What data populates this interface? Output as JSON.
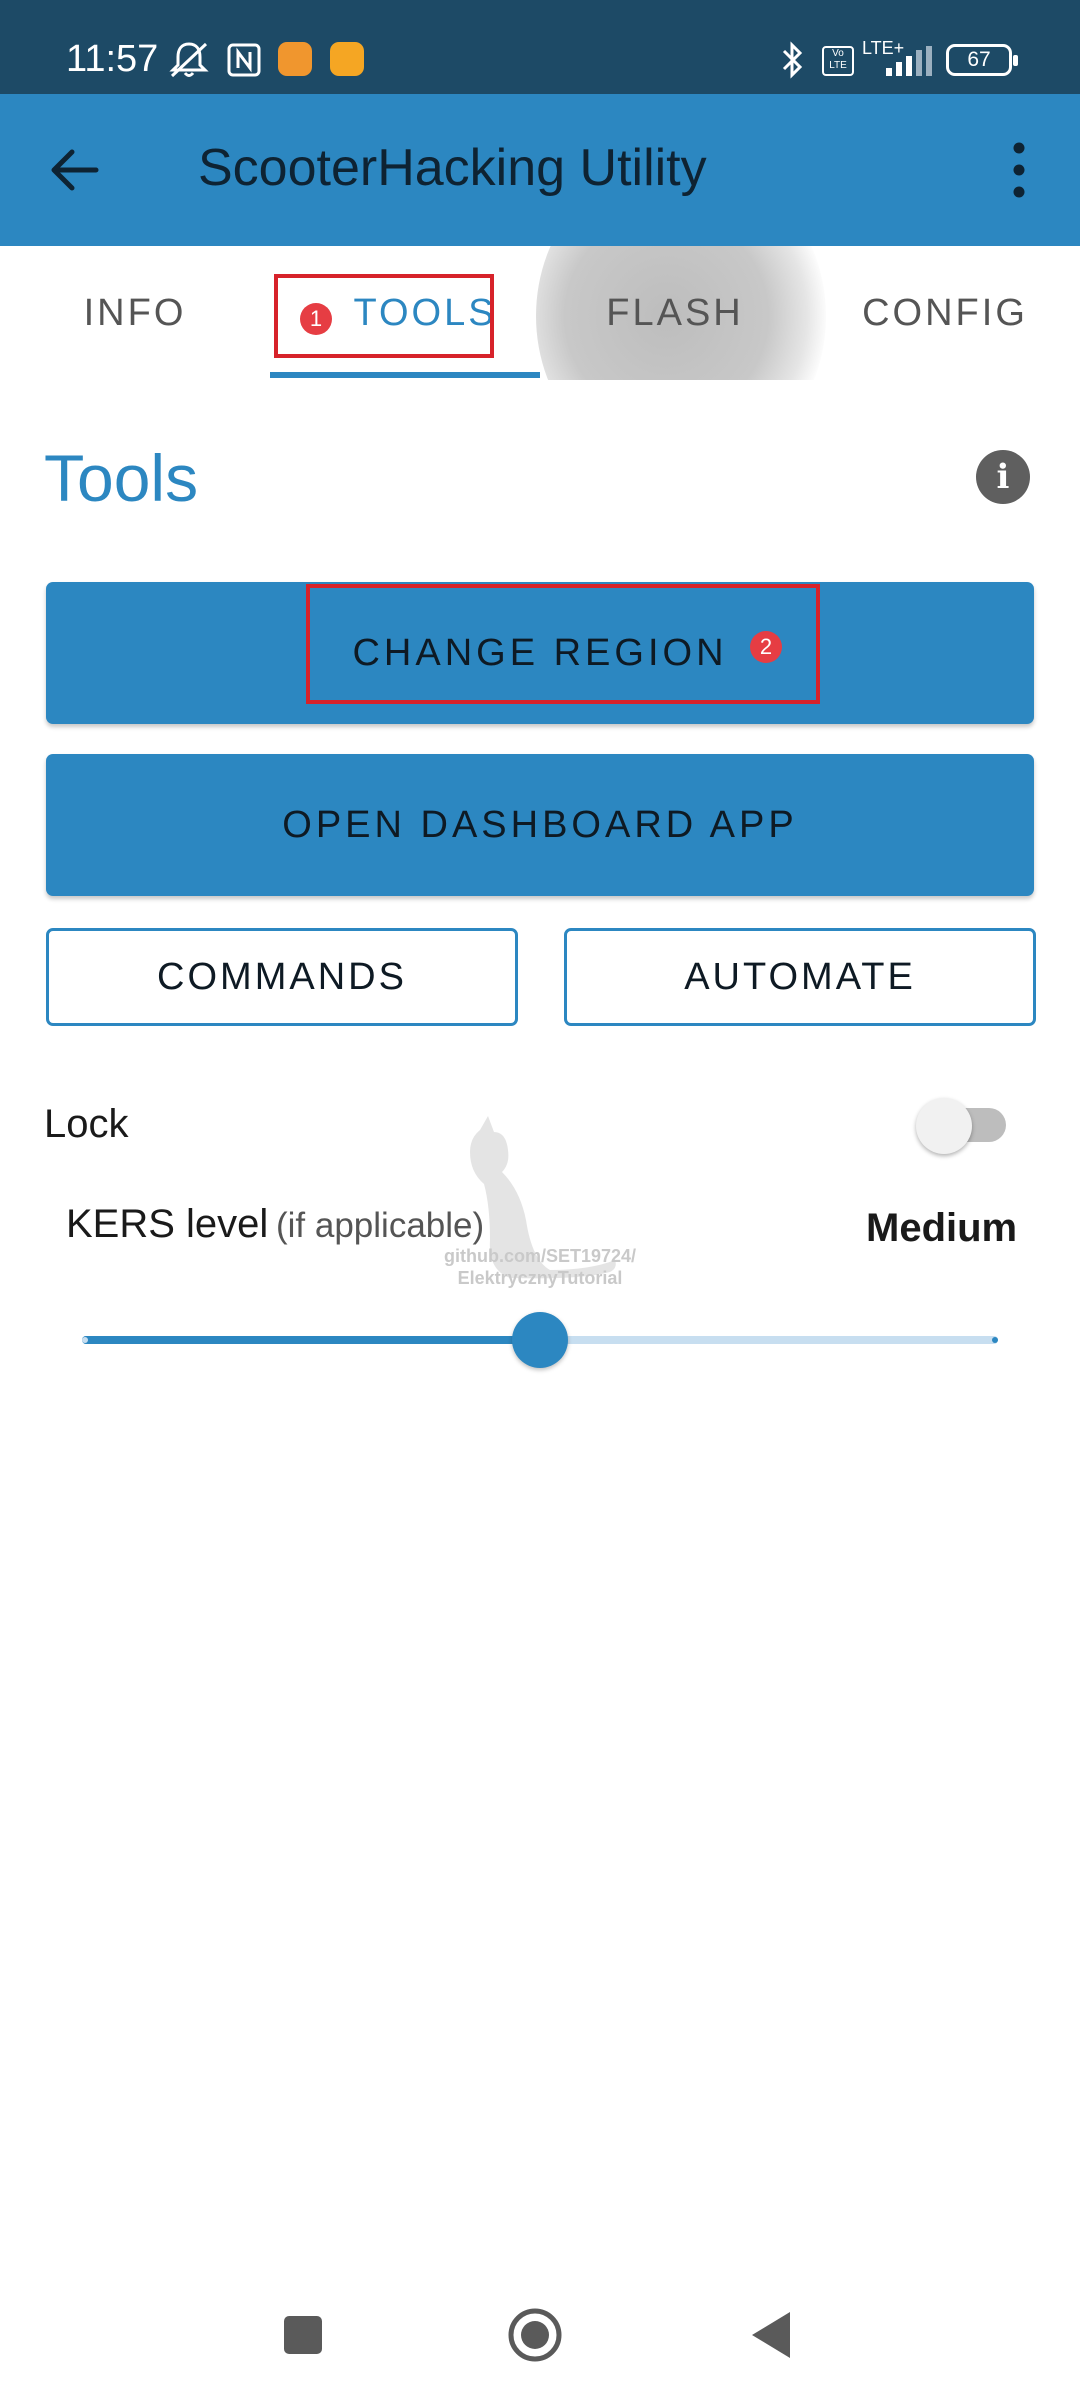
{
  "status_bar": {
    "time": "11:57",
    "battery": "67",
    "network": "LTE+",
    "volte": "Vo LTE",
    "icons": [
      "mute-bell-icon",
      "nfc-icon",
      "app-notification-icon",
      "message-notification-icon",
      "bluetooth-icon",
      "signal-icon",
      "battery-icon"
    ]
  },
  "app_bar": {
    "title": "ScooterHacking Utility",
    "back_icon": "arrow-left-icon",
    "menu_icon": "more-vert-icon"
  },
  "tabs": [
    {
      "label": "INFO",
      "selected": false
    },
    {
      "label": "TOOLS",
      "selected": true
    },
    {
      "label": "FLASH",
      "selected": false
    },
    {
      "label": "CONFIG",
      "selected": false
    }
  ],
  "annotations": {
    "step1": "1",
    "step2": "2",
    "highlight_color": "#d7222a"
  },
  "content": {
    "title": "Tools",
    "info_icon": "i",
    "buttons": {
      "change_region": "CHANGE REGION",
      "open_dashboard": "OPEN DASHBOARD APP",
      "commands": "COMMANDS",
      "automate": "AUTOMATE"
    },
    "lock": {
      "label": "Lock",
      "enabled": false
    },
    "kers": {
      "label": "KERS level",
      "hint": "(if applicable)",
      "value_label": "Medium",
      "level": 0.5
    }
  },
  "watermark": {
    "line1": "github.com/SET19724/",
    "line2": "ElektrycznyTutorial"
  },
  "colors": {
    "primary": "#2c87c1",
    "status_bar": "#1d4a66",
    "badge": "#e63d43"
  }
}
